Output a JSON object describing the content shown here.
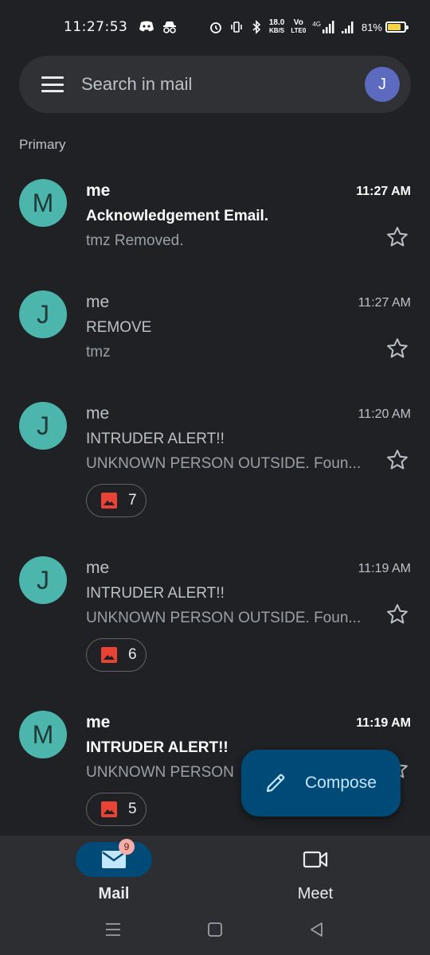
{
  "status_bar": {
    "time": "11:27:53",
    "net_speed_value": "18.0",
    "net_speed_unit": "KB/S",
    "volte_top": "Vo",
    "volte_bottom": "LTE0",
    "network": "4G",
    "battery_percent": "81%",
    "battery_level": 0.81,
    "battery_color": "#f5d547",
    "icons": [
      "discord-icon",
      "incognito-icon",
      "alarm-icon",
      "vibrate-icon",
      "bluetooth-icon",
      "signal-icon",
      "signal-icon",
      "battery-icon"
    ]
  },
  "search": {
    "placeholder": "Search in mail",
    "avatar_initial": "J",
    "avatar_color": "#5c6bc0"
  },
  "section_label": "Primary",
  "emails": [
    {
      "avatar": "M",
      "sender": "me",
      "time": "11:27 AM",
      "subject": "Acknowledgement Email.",
      "snippet": "tmz Removed.",
      "unread": true,
      "starred": false
    },
    {
      "avatar": "J",
      "sender": "me",
      "time": "11:27 AM",
      "subject": "REMOVE",
      "snippet": "tmz",
      "unread": false,
      "starred": false
    },
    {
      "avatar": "J",
      "sender": "me",
      "time": "11:20 AM",
      "subject": "INTRUDER ALERT!!",
      "snippet": "UNKNOWN PERSON OUTSIDE. Foun...",
      "unread": false,
      "starred": false,
      "attachments": "7"
    },
    {
      "avatar": "J",
      "sender": "me",
      "time": "11:19 AM",
      "subject": "INTRUDER ALERT!!",
      "snippet": "UNKNOWN PERSON OUTSIDE. Foun...",
      "unread": false,
      "starred": false,
      "attachments": "6"
    },
    {
      "avatar": "M",
      "sender": "me",
      "time": "11:19 AM",
      "subject": "INTRUDER ALERT!!",
      "snippet": "UNKNOWN PERSON",
      "unread": true,
      "starred": false,
      "attachments": "5"
    }
  ],
  "compose": {
    "label": "Compose",
    "color": "#004a77"
  },
  "bottom_nav": {
    "mail_label": "Mail",
    "mail_badge": "9",
    "meet_label": "Meet"
  },
  "system_nav": [
    "menu-icon",
    "home-icon",
    "back-icon"
  ],
  "colors": {
    "background": "#202124",
    "avatar_teal": "#4db6ac",
    "attachment_icon": "#ea4335",
    "surface": "#2d2e31"
  }
}
